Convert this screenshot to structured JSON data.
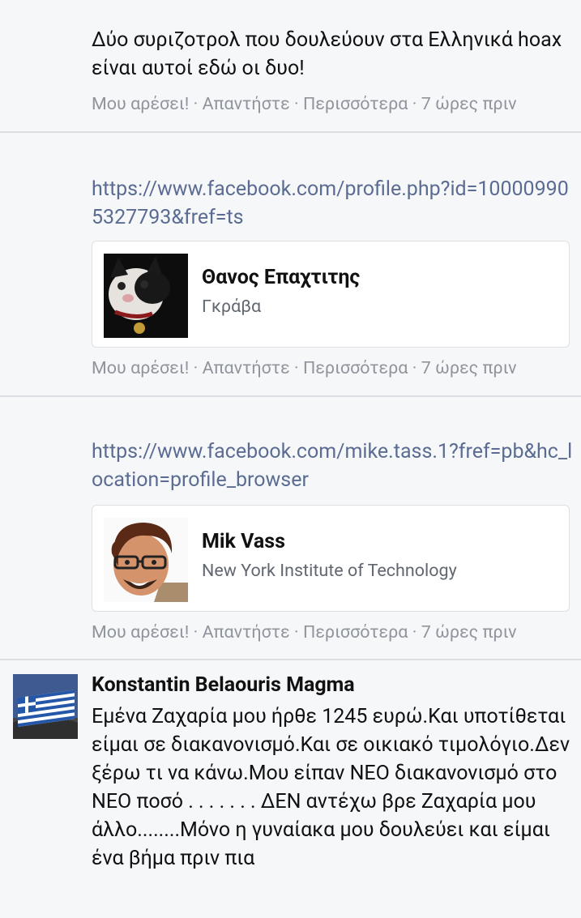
{
  "comments": [
    {
      "text": "Δύο συριζοτρολ που δουλεύουν στα Ελληνικά hoax είναι αυτοί εδώ οι δυο!",
      "actions": {
        "like": "Μου αρέσει!",
        "reply": "Απαντήστε",
        "more": "Περισσότερα",
        "time": "7 ώρες πριν",
        "sep": " · "
      }
    },
    {
      "link": "https://www.facebook.com/profile.php?id=100009905327793&fref=ts",
      "card": {
        "name": "Θανος Επαχτιτης",
        "subtitle": "Γκράβα",
        "thumb_icon": "cat-photo"
      },
      "actions": {
        "like": "Μου αρέσει!",
        "reply": "Απαντήστε",
        "more": "Περισσότερα",
        "time": "7 ώρες πριν",
        "sep": " · "
      }
    },
    {
      "link": "https://www.facebook.com/mike.tass.1?fref=pb&hc_location=profile_browser",
      "card": {
        "name": "Mik Vass",
        "subtitle": "New York Institute of Technology",
        "thumb_icon": "cartoon-man-avatar"
      },
      "actions": {
        "like": "Μου αρέσει!",
        "reply": "Απαντήστε",
        "more": "Περισσότερα",
        "time": "7 ώρες πριν",
        "sep": " · "
      }
    },
    {
      "author": "Konstantin Belaouris Magma",
      "avatar_icon": "greek-flag-avatar",
      "text": "Εμένα Ζαχαρία μου ήρθε 1245 ευρώ.Και υποτίθεται είμαι σε διακανονισμό.Και σε οικιακό τιμολόγιο.Δεν ξέρω τι να κάνω.Μου είπαν ΝΕΟ διακανονισμό στο ΝΕΟ ποσό . . . . . . . ΔΕΝ αντέχω βρε Ζαχαρία μου άλλο........Μόνο η γυναίακα μου δουλεύει και είμαι ένα βήμα πριν πια"
    }
  ],
  "colors": {
    "background": "#f6f7f9",
    "link": "#5b6c93",
    "meta": "#90949c",
    "divider": "#dcdee3"
  }
}
